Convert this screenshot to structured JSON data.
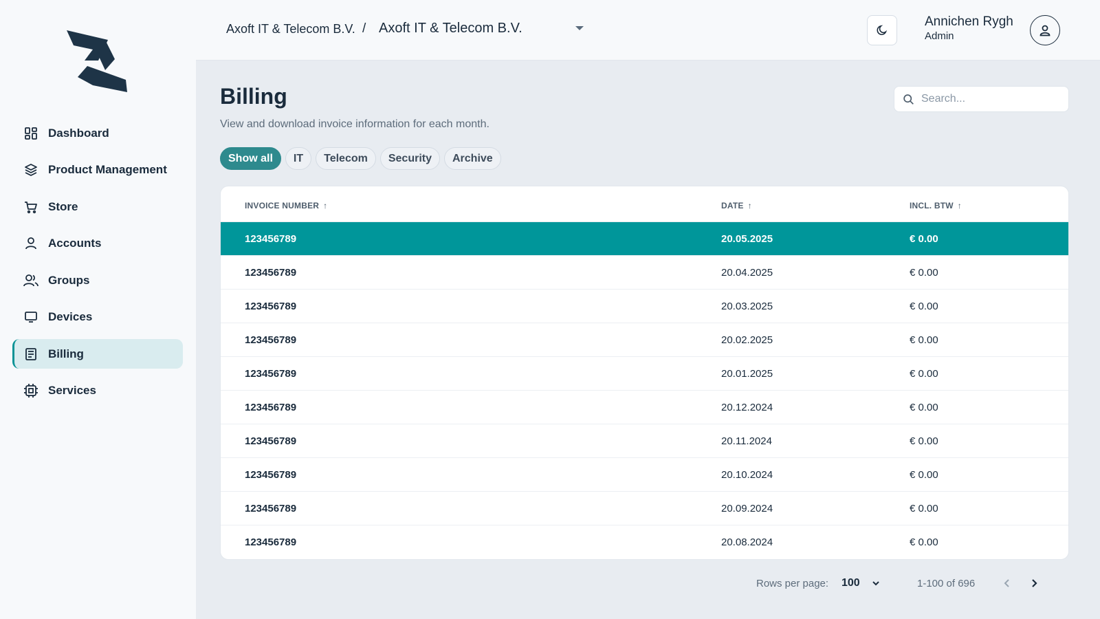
{
  "sidebar": {
    "items": [
      {
        "label": "Dashboard",
        "icon": "dashboard-icon"
      },
      {
        "label": "Product Management",
        "icon": "layers-icon"
      },
      {
        "label": "Store",
        "icon": "cart-icon"
      },
      {
        "label": "Accounts",
        "icon": "user-icon"
      },
      {
        "label": "Groups",
        "icon": "users-icon"
      },
      {
        "label": "Devices",
        "icon": "monitor-icon"
      },
      {
        "label": "Billing",
        "icon": "receipt-icon",
        "active": true
      },
      {
        "label": "Services",
        "icon": "chip-icon"
      }
    ]
  },
  "header": {
    "breadcrumb_parent": "Axoft IT & Telecom B.V.",
    "breadcrumb_separator": "/",
    "breadcrumb_current": "Axoft IT & Telecom B.V.",
    "user_name": "Annichen Rygh",
    "user_role": "Admin"
  },
  "page": {
    "title": "Billing",
    "subtitle": "View and download invoice information for each month.",
    "search_placeholder": "Search..."
  },
  "filters": [
    "Show all",
    "IT",
    "Telecom",
    "Security",
    "Archive"
  ],
  "table": {
    "columns": [
      "INVOICE NUMBER",
      "DATE",
      "INCL. BTW"
    ],
    "sort_arrow": "↑",
    "rows": [
      {
        "invoice": "123456789",
        "date": "20.05.2025",
        "amount": "€ 0.00"
      },
      {
        "invoice": "123456789",
        "date": "20.04.2025",
        "amount": "€ 0.00"
      },
      {
        "invoice": "123456789",
        "date": "20.03.2025",
        "amount": "€ 0.00"
      },
      {
        "invoice": "123456789",
        "date": "20.02.2025",
        "amount": "€ 0.00"
      },
      {
        "invoice": "123456789",
        "date": "20.01.2025",
        "amount": "€ 0.00"
      },
      {
        "invoice": "123456789",
        "date": "20.12.2024",
        "amount": "€ 0.00"
      },
      {
        "invoice": "123456789",
        "date": "20.11.2024",
        "amount": "€ 0.00"
      },
      {
        "invoice": "123456789",
        "date": "20.10.2024",
        "amount": "€ 0.00"
      },
      {
        "invoice": "123456789",
        "date": "20.09.2024",
        "amount": "€ 0.00"
      },
      {
        "invoice": "123456789",
        "date": "20.08.2024",
        "amount": "€ 0.00"
      }
    ]
  },
  "pagination": {
    "rows_per_page_label": "Rows per page:",
    "rows_per_page_value": "100",
    "range": "1-100 of 696"
  },
  "colors": {
    "accent": "#00969a",
    "active_chip": "#2e8a8e",
    "sidebar_active": "#d9ecef",
    "text": "#1a2b3c"
  }
}
